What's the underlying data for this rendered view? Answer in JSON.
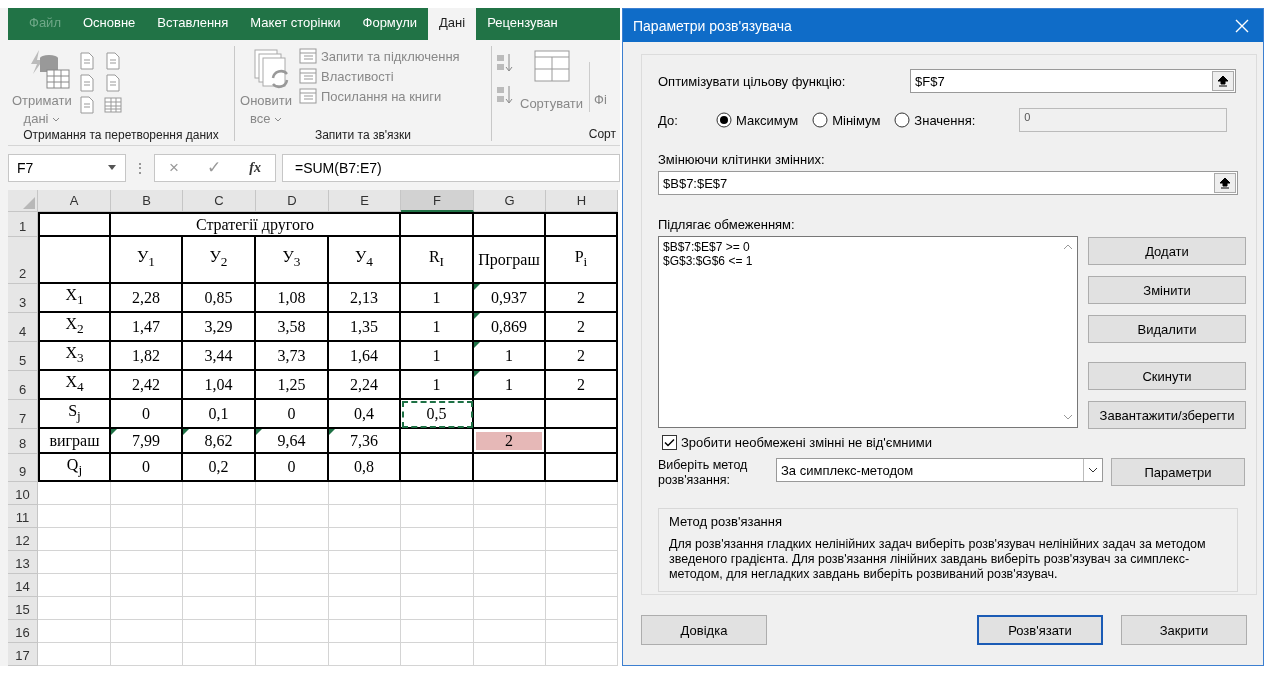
{
  "ribbon": {
    "disabled": true,
    "tabs": [
      {
        "label": "Файл",
        "selected": false,
        "kind": "file"
      },
      {
        "label": "Основне",
        "selected": false,
        "kind": "tab"
      },
      {
        "label": "Вставлення",
        "selected": false,
        "kind": "tab"
      },
      {
        "label": "Макет сторінки",
        "selected": false,
        "kind": "tab"
      },
      {
        "label": "Формули",
        "selected": false,
        "kind": "tab"
      },
      {
        "label": "Дані",
        "selected": true,
        "kind": "tab"
      },
      {
        "label": "Рецензуван",
        "selected": false,
        "kind": "tab"
      }
    ],
    "get_data": {
      "label_lines": [
        "Отримати",
        "дані"
      ],
      "group": "Отримання та перетворення даних"
    },
    "queries": {
      "refresh_lines": [
        "Оновити",
        "все"
      ],
      "items": [
        "Запити та підключення",
        "Властивості",
        "Посилання на книги"
      ],
      "group": "Запити та зв'язки"
    },
    "sort": {
      "label": "Сортувати",
      "filter": "Фі",
      "group": "Сорт"
    }
  },
  "formula_bar": {
    "name_box": "F7",
    "more": "⋮",
    "cancel": "×",
    "enter": "✓",
    "fx": "fx",
    "formula": "=SUM(B7:E7)"
  },
  "sheet": {
    "columns": [
      {
        "label": "A",
        "selected": false
      },
      {
        "label": "B",
        "selected": false
      },
      {
        "label": "C",
        "selected": false
      },
      {
        "label": "D",
        "selected": false
      },
      {
        "label": "E",
        "selected": false
      },
      {
        "label": "F",
        "selected": true
      },
      {
        "label": "G",
        "selected": false
      },
      {
        "label": "H",
        "selected": false
      }
    ],
    "rows": [
      {
        "header": "1",
        "cells": [
          {},
          {
            "text": "Стратегії другого",
            "kind": "merged"
          },
          {},
          {},
          {}
        ]
      },
      {
        "header": "2",
        "cells": [
          {},
          {
            "text": "У$_{1}$"
          },
          {
            "text": "У$_{2}$"
          },
          {
            "text": "У$_{3}$"
          },
          {
            "text": "У$_{4}$"
          },
          {
            "text": "R$_{I}$"
          },
          {
            "text": "Програш"
          },
          {
            "text": "P$_{i}$"
          }
        ]
      },
      {
        "header": "3",
        "cells": [
          {
            "text": "X$_{1}$"
          },
          {
            "text": "2,28"
          },
          {
            "text": "0,85"
          },
          {
            "text": "1,08"
          },
          {
            "text": "2,13"
          },
          {
            "text": "1"
          },
          {
            "text": "0,937",
            "marker": true
          },
          {
            "text": "2"
          }
        ]
      },
      {
        "header": "4",
        "cells": [
          {
            "text": "X$_{2}$"
          },
          {
            "text": "1,47"
          },
          {
            "text": "3,29"
          },
          {
            "text": "3,58"
          },
          {
            "text": "1,35"
          },
          {
            "text": "1"
          },
          {
            "text": "0,869",
            "marker": true
          },
          {
            "text": "2"
          }
        ]
      },
      {
        "header": "5",
        "cells": [
          {
            "text": "X$_{3}$"
          },
          {
            "text": "1,82"
          },
          {
            "text": "3,44"
          },
          {
            "text": "3,73"
          },
          {
            "text": "1,64"
          },
          {
            "text": "1"
          },
          {
            "text": "1",
            "marker": true
          },
          {
            "text": "2"
          }
        ]
      },
      {
        "header": "6",
        "cells": [
          {
            "text": "X$_{4}$"
          },
          {
            "text": "2,42"
          },
          {
            "text": "1,04"
          },
          {
            "text": "1,25"
          },
          {
            "text": "2,24"
          },
          {
            "text": "1"
          },
          {
            "text": "1",
            "marker": true
          },
          {
            "text": "2"
          }
        ]
      },
      {
        "header": "7",
        "cells": [
          {
            "text": "S$_{j}$"
          },
          {
            "text": "0"
          },
          {
            "text": "0,1"
          },
          {
            "text": "0"
          },
          {
            "text": "0,4"
          },
          {
            "text": "0,5",
            "marquee": true
          },
          {},
          {}
        ]
      },
      {
        "header": "8",
        "cells": [
          {
            "text": "виграш"
          },
          {
            "text": "7,99",
            "marker": true
          },
          {
            "text": "8,62",
            "marker": true
          },
          {
            "text": "9,64",
            "marker": true
          },
          {
            "text": "7,36",
            "marker": true
          },
          {},
          {
            "text": "2",
            "highlight": true
          },
          {}
        ]
      },
      {
        "header": "9",
        "cells": [
          {
            "text": "Q$_{j}$"
          },
          {
            "text": "0"
          },
          {
            "text": "0,2"
          },
          {
            "text": "0"
          },
          {
            "text": "0,8"
          },
          {},
          {},
          {}
        ]
      },
      {
        "header": "10"
      },
      {
        "header": "11"
      },
      {
        "header": "12"
      },
      {
        "header": "13"
      },
      {
        "header": "14"
      },
      {
        "header": "15"
      },
      {
        "header": "16"
      },
      {
        "header": "17"
      }
    ]
  },
  "dialog": {
    "title": "Параметри розв'язувача",
    "objective_label": "Оптимізувати цільову функцію:",
    "objective_value": "$F$7",
    "to_label": "До:",
    "options": [
      {
        "label": "Максимум",
        "selected": true
      },
      {
        "label": "Мінімум",
        "selected": false
      },
      {
        "label": "Значення:",
        "selected": false
      }
    ],
    "target_value": "0",
    "variables_label": "Змінюючи клітинки змінних:",
    "variables_value": "$B$7:$E$7",
    "constraints_label": "Підлягає обмеженням:",
    "constraints": [
      "$B$7:$E$7 >= 0",
      "$G$3:$G$6 <= 1"
    ],
    "side_buttons": [
      "Додати",
      "Змінити",
      "Видалити",
      "Скинути",
      "Завантажити/зберегти"
    ],
    "nonnegative": {
      "label": "Зробити необмежені змінні не від'ємними",
      "checked": true
    },
    "method_label": "Виберіть метод розв'язання:",
    "method_value": "За симплекс-методом",
    "options_button": "Параметри",
    "info": {
      "title": "Метод розв'язання",
      "text": "Для розв'язання гладких нелінійних задач виберіть розв'язувач нелінійних задач за методом зведеного градієнта. Для розв'язання лінійних завдань виберіть розв'язувач за симплекс-методом, для негладких завдань виберіть розвиваний розв'язувач."
    },
    "buttons": [
      {
        "label": "Довідка",
        "default": false
      },
      {
        "label": "Розв'язати",
        "default": true
      },
      {
        "label": "Закрити",
        "default": false
      }
    ]
  }
}
